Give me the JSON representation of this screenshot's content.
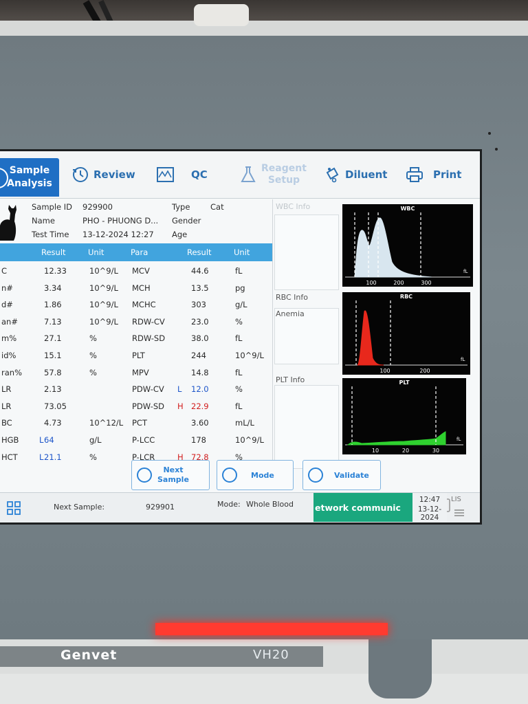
{
  "device": {
    "brand": "Genvet",
    "model": "VH20"
  },
  "nav": {
    "sample_analysis": [
      "Sample",
      "Analysis"
    ],
    "review": "Review",
    "qc": "QC",
    "reagent_setup": [
      "Reagent",
      "Setup"
    ],
    "diluent": "Diluent",
    "print": "Print"
  },
  "patient": {
    "sample_id_label": "Sample ID",
    "sample_id": "929900",
    "type_label": "Type",
    "type": "Cat",
    "name_label": "Name",
    "name": "PHO - PHUONG D...",
    "gender_label": "Gender",
    "test_time_label": "Test Time",
    "test_time": "13-12-2024 12:27",
    "age_label": "Age"
  },
  "table_headers": {
    "left": [
      "Result",
      "Unit"
    ],
    "right": [
      "Para",
      "Result",
      "Unit"
    ]
  },
  "rows": [
    {
      "lp": "C",
      "lr": "12.33",
      "lf": "",
      "lu": "10^9/L",
      "rp": "MCV",
      "rr": "44.6",
      "rf": "",
      "ru": "fL"
    },
    {
      "lp": "n#",
      "lr": "3.34",
      "lf": "",
      "lu": "10^9/L",
      "rp": "MCH",
      "rr": "13.5",
      "rf": "",
      "ru": "pg"
    },
    {
      "lp": "d#",
      "lr": "1.86",
      "lf": "",
      "lu": "10^9/L",
      "rp": "MCHC",
      "rr": "303",
      "rf": "",
      "ru": "g/L"
    },
    {
      "lp": "an#",
      "lr": "7.13",
      "lf": "",
      "lu": "10^9/L",
      "rp": "RDW-CV",
      "rr": "23.0",
      "rf": "",
      "ru": "%"
    },
    {
      "lp": "m%",
      "lr": "27.1",
      "lf": "",
      "lu": "%",
      "rp": "RDW-SD",
      "rr": "38.0",
      "rf": "",
      "ru": "fL"
    },
    {
      "lp": "id%",
      "lr": "15.1",
      "lf": "",
      "lu": "%",
      "rp": "PLT",
      "rr": "244",
      "rf": "",
      "ru": "10^9/L"
    },
    {
      "lp": "ran%",
      "lr": "57.8",
      "lf": "",
      "lu": "%",
      "rp": "MPV",
      "rr": "14.8",
      "rf": "",
      "ru": "fL"
    },
    {
      "lp": "LR",
      "lr": "2.13",
      "lf": "",
      "lu": "",
      "rp": "PDW-CV",
      "rr": "12.0",
      "rf": "L",
      "ru": "%"
    },
    {
      "lp": "LR",
      "lr": "73.05",
      "lf": "",
      "lu": "",
      "rp": "PDW-SD",
      "rr": "22.9",
      "rf": "H",
      "ru": "fL"
    },
    {
      "lp": "BC",
      "lr": "4.73",
      "lf": "",
      "lu": "10^12/L",
      "rp": "PCT",
      "rr": "3.60",
      "rf": "",
      "ru": "mL/L"
    },
    {
      "lp": "HGB",
      "lr": "64",
      "lf": "L",
      "lu": "g/L",
      "rp": "P-LCC",
      "rr": "178",
      "rf": "",
      "ru": "10^9/L"
    },
    {
      "lp": "HCT",
      "lr": "21.1",
      "lf": "L",
      "lu": "%",
      "rp": "P-LCR",
      "rr": "72.8",
      "rf": "H",
      "ru": "%"
    }
  ],
  "info": {
    "wbc_info": "WBC Info",
    "rbc_info": "RBC Info",
    "rbc_flag": "Anemia",
    "plt_info": "PLT Info"
  },
  "histograms": {
    "wbc": {
      "title": "WBC",
      "unit": "fL",
      "ticks": [
        "100",
        "200",
        "300"
      ],
      "color": "#d8e6ef"
    },
    "rbc": {
      "title": "RBC",
      "unit": "fL",
      "ticks": [
        "100",
        "200"
      ],
      "color": "#e8281c"
    },
    "plt": {
      "title": "PLT",
      "unit": "fL",
      "ticks": [
        "10",
        "20",
        "30"
      ],
      "color": "#2fd12f"
    }
  },
  "actions": {
    "next_sample": [
      "Next",
      "Sample"
    ],
    "mode": "Mode",
    "validate": "Validate"
  },
  "status": {
    "next_sample_label": "Next Sample:",
    "next_sample": "929901",
    "mode_label": "Mode:",
    "mode": "Whole Blood",
    "network": "etwork communic",
    "time": "12:47",
    "date": "13-12-2024",
    "lis": "LIS"
  }
}
